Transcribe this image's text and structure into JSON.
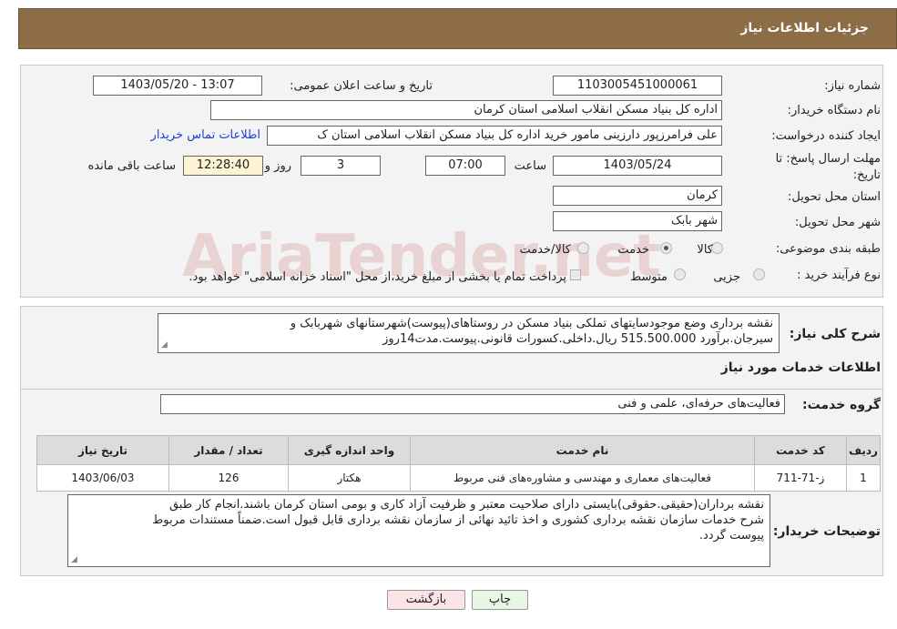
{
  "header": {
    "title": "جزئیات اطلاعات نیاز"
  },
  "fields": {
    "need_number_label": "شماره نیاز:",
    "need_number": "1103005451000061",
    "announce_label": "تاریخ و ساعت اعلان عمومی:",
    "announce_value": "1403/05/20 - 13:07",
    "buyer_org_label": "نام دستگاه خریدار:",
    "buyer_org": "اداره کل بنیاد مسکن انقلاب اسلامی استان کرمان",
    "creator_label": "ایجاد کننده درخواست:",
    "creator": "علی فرامرزپور دارزینی مامور خرید اداره کل بنیاد مسکن انقلاب اسلامی استان ک",
    "contact_link": "اطلاعات تماس خریدار",
    "deadline_label_1": "مهلت ارسال پاسخ: تا",
    "deadline_label_2": "تاریخ:",
    "deadline_date": "1403/05/24",
    "time_label": "ساعت",
    "deadline_time": "07:00",
    "days": "3",
    "days_label": "روز و",
    "remaining_time": "12:28:40",
    "remaining_label": "ساعت باقی مانده",
    "province_label": "استان محل تحویل:",
    "province": "کرمان",
    "city_label": "شهر محل تحویل:",
    "city": "شهر بابک",
    "category_label": "طبقه بندی موضوعی:",
    "category_options": [
      "کالا",
      "خدمت",
      "کالا/خدمت"
    ],
    "category_selected": "خدمت",
    "process_label": "نوع فرآیند خرید :",
    "process_options": [
      "جزیی",
      "متوسط"
    ],
    "payment_note": "پرداخت تمام یا بخشی از مبلغ خرید،از محل \"اسناد خزانه اسلامی\" خواهد بود."
  },
  "summary": {
    "label": "شرح کلی نیاز:",
    "line1": "نقشه برداری وضع موجودسایتهای تملکی بنیاد مسکن در روستاهای(پیوست)شهرستانهای شهربابک و",
    "line2": "سیرجان.برآورد 515.500.000 ریال.داخلی.کسورات قانونی.پیوست.مدت14روز"
  },
  "services": {
    "section_title": "اطلاعات خدمات مورد نیاز",
    "group_label": "گروه خدمت:",
    "group_value": "فعالیت‌های حرفه‌ای، علمی و فنی",
    "columns": [
      "ردیف",
      "کد خدمت",
      "نام خدمت",
      "واحد اندازه گیری",
      "تعداد / مقدار",
      "تاریخ نیاز"
    ],
    "rows": [
      [
        "1",
        "ز-71-711",
        "فعالیت‌های معماری و مهندسی و مشاوره‌های فنی مربوط",
        "هکتار",
        "126",
        "1403/06/03"
      ]
    ]
  },
  "buyer_notes": {
    "label": "توضیحات خریدار:",
    "line1": "نقشه برداران(حقیقی.حقوقی)بایستی دارای صلاحیت معتبر و ظرفیت آزاد کاری و بومی استان کرمان باشند.انجام کار طبق",
    "line2": "شرح خدمات سازمان نقشه برداری کشوری و اخذ تائید نهائی از سازمان نقشه برداری قابل قبول است.ضمناً مستندات مربوط",
    "line3": "پیوست گردد."
  },
  "buttons": {
    "print": "چاپ",
    "back": "بازگشت"
  },
  "watermark": "AriaTender.net"
}
